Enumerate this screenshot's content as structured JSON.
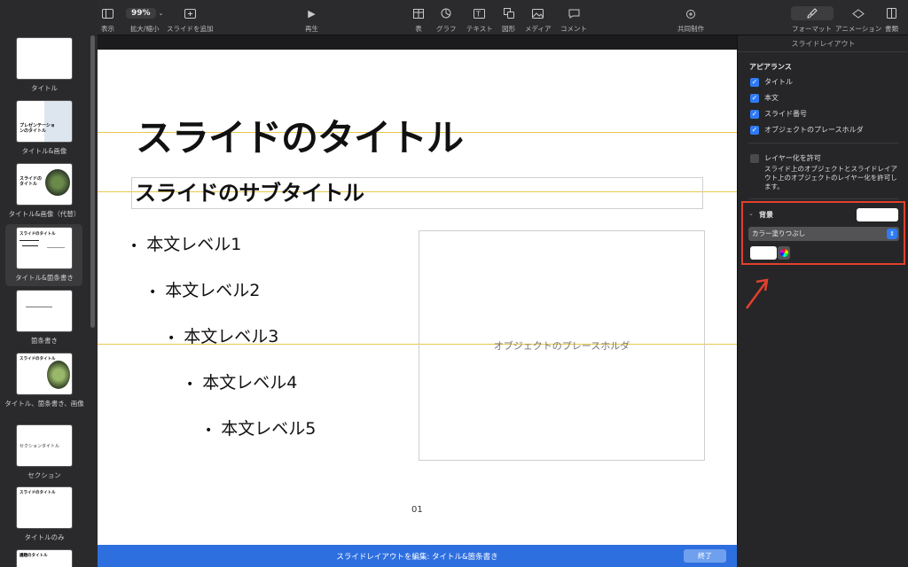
{
  "toolbar": {
    "zoom_value": "99%",
    "items": [
      {
        "label": "表示",
        "icon": "sidebar-icon"
      },
      {
        "label": "拡大/縮小",
        "icon": "zoom-icon"
      },
      {
        "label": "スライドを追加",
        "icon": "add-slide-icon"
      },
      {
        "label": "再生",
        "icon": "play-icon"
      },
      {
        "label": "表",
        "icon": "table-icon"
      },
      {
        "label": "グラフ",
        "icon": "chart-icon"
      },
      {
        "label": "テキスト",
        "icon": "text-icon"
      },
      {
        "label": "図形",
        "icon": "shape-icon"
      },
      {
        "label": "メディア",
        "icon": "media-icon"
      },
      {
        "label": "コメント",
        "icon": "comment-icon"
      },
      {
        "label": "共同制作",
        "icon": "collaborate-icon"
      },
      {
        "label": "フォーマット",
        "icon": "format-icon"
      },
      {
        "label": "アニメーション",
        "icon": "animate-icon"
      },
      {
        "label": "書類",
        "icon": "document-icon"
      }
    ]
  },
  "navigator": {
    "layouts": [
      {
        "label": "タイトル"
      },
      {
        "label": "タイトル&画像",
        "thumb_text": "プレゼンテーションのタイトル"
      },
      {
        "label": "タイトル&画像（代替）",
        "thumb_text": "スライドのタイトル"
      },
      {
        "label": "タイトル&箇条書き",
        "thumb_text": "スライドのタイトル",
        "selected": true
      },
      {
        "label": "箇条書き"
      },
      {
        "label": "タイトル、箇条書き、画像",
        "thumb_text": "スライドのタイトル"
      },
      {
        "label": "セクション",
        "thumb_text": "セクションタイトル"
      },
      {
        "label": "タイトルのみ",
        "thumb_text": "スライドのタイトル"
      },
      {
        "label": "",
        "thumb_text": "議題のタイトル"
      }
    ]
  },
  "slide": {
    "title": "スライドのタイトル",
    "subtitle": "スライドのサブタイトル",
    "bullets": [
      "本文レベル1",
      "本文レベル2",
      "本文レベル3",
      "本文レベル4",
      "本文レベル5"
    ],
    "object_placeholder": "オブジェクトのプレースホルダ",
    "slide_number": "01"
  },
  "inspector": {
    "title": "スライドレイアウト",
    "appearance_heading": "アピアランス",
    "appearance_options": [
      {
        "label": "タイトル",
        "checked": true
      },
      {
        "label": "本文",
        "checked": true
      },
      {
        "label": "スライド番号",
        "checked": true
      },
      {
        "label": "オブジェクトのプレースホルダ",
        "checked": true
      }
    ],
    "layering": {
      "label": "レイヤー化を許可",
      "checked": false,
      "description": "スライド上のオブジェクトとスライドレイアウト上のオブジェクトのレイヤー化を許可します。"
    },
    "background": {
      "heading": "背景",
      "fill_type": "カラー塗りつぶし",
      "color": "#ffffff"
    }
  },
  "bottom_bar": {
    "edit_label": "スライドレイアウトを編集: タイトル&箇条書き",
    "done_label": "終了"
  },
  "colors": {
    "accent": "#2f7bf6",
    "highlight": "#e2402d",
    "edit_bar": "#2e6fe0"
  }
}
